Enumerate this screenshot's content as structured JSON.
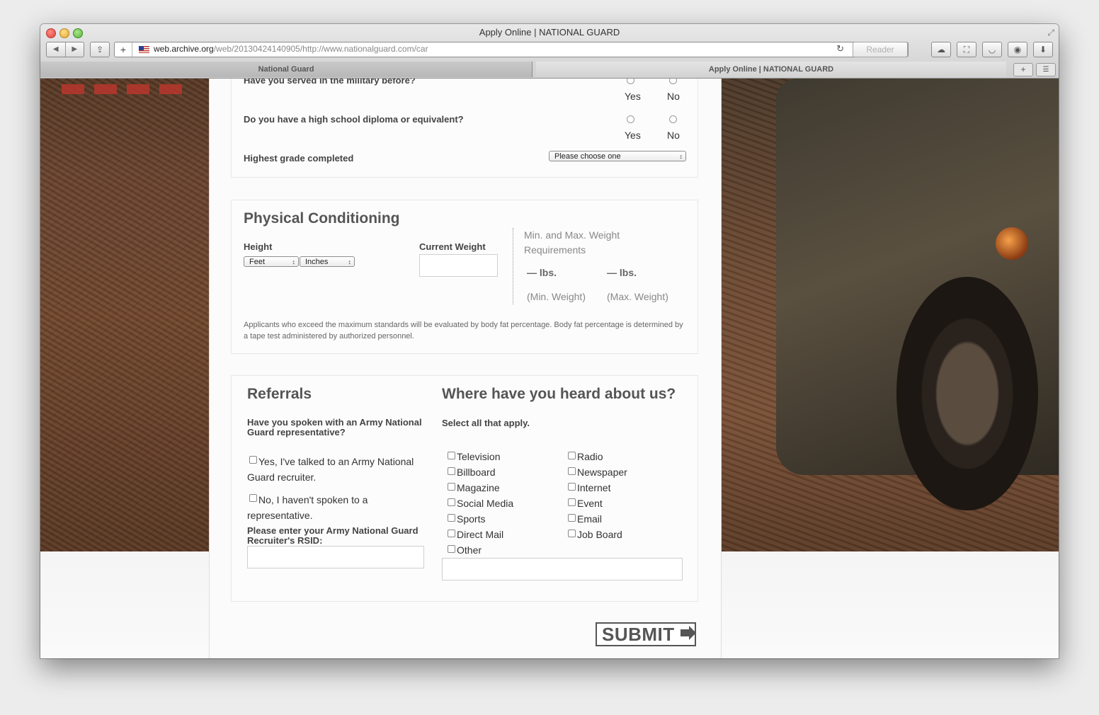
{
  "browser": {
    "window_title": "Apply Online | NATIONAL GUARD",
    "url_host": "web.archive.org",
    "url_rest": "/web/20130424140905/http://www.nationalguard.com/car",
    "reader_label": "Reader",
    "tabs": [
      {
        "label": "National Guard"
      },
      {
        "label": "Apply Online | NATIONAL GUARD"
      }
    ]
  },
  "form": {
    "served_question": "Have you served in the military before?",
    "diploma_question": "Do you have a high school diploma or equivalent?",
    "yes_label": "Yes",
    "no_label": "No",
    "grade_label": "Highest grade completed",
    "grade_select": "Please choose one",
    "physical": {
      "title": "Physical Conditioning",
      "height_label": "Height",
      "feet_select": "Feet",
      "inches_select": "Inches",
      "weight_label": "Current Weight",
      "req_title": "Min. and Max. Weight Requirements",
      "min_value": "— lbs.",
      "max_value": "— lbs.",
      "min_caption": "(Min. Weight)",
      "max_caption": "(Max. Weight)",
      "note": "Applicants who exceed the maximum standards will be evaluated by body fat percentage. Body fat percentage is determined by a tape test administered by authorized personnel."
    },
    "referrals": {
      "title": "Referrals",
      "question": "Have you spoken with an Army National Guard representative?",
      "option_yes": "Yes, I've talked to an Army National Guard recruiter.",
      "option_no": "No, I haven't spoken to a representative.",
      "rsid_label": "Please enter your Army National Guard Recruiter's RSID:"
    },
    "heard": {
      "title": "Where have you heard about us?",
      "instruction": "Select all that apply.",
      "col1": [
        "Television",
        "Billboard",
        "Magazine",
        "Social Media",
        "Sports",
        "Direct Mail",
        "Other"
      ],
      "col2": [
        "Radio",
        "Newspaper",
        "Internet",
        "Event",
        "Email",
        "Job Board"
      ]
    },
    "submit_label": "SUBMIT"
  }
}
